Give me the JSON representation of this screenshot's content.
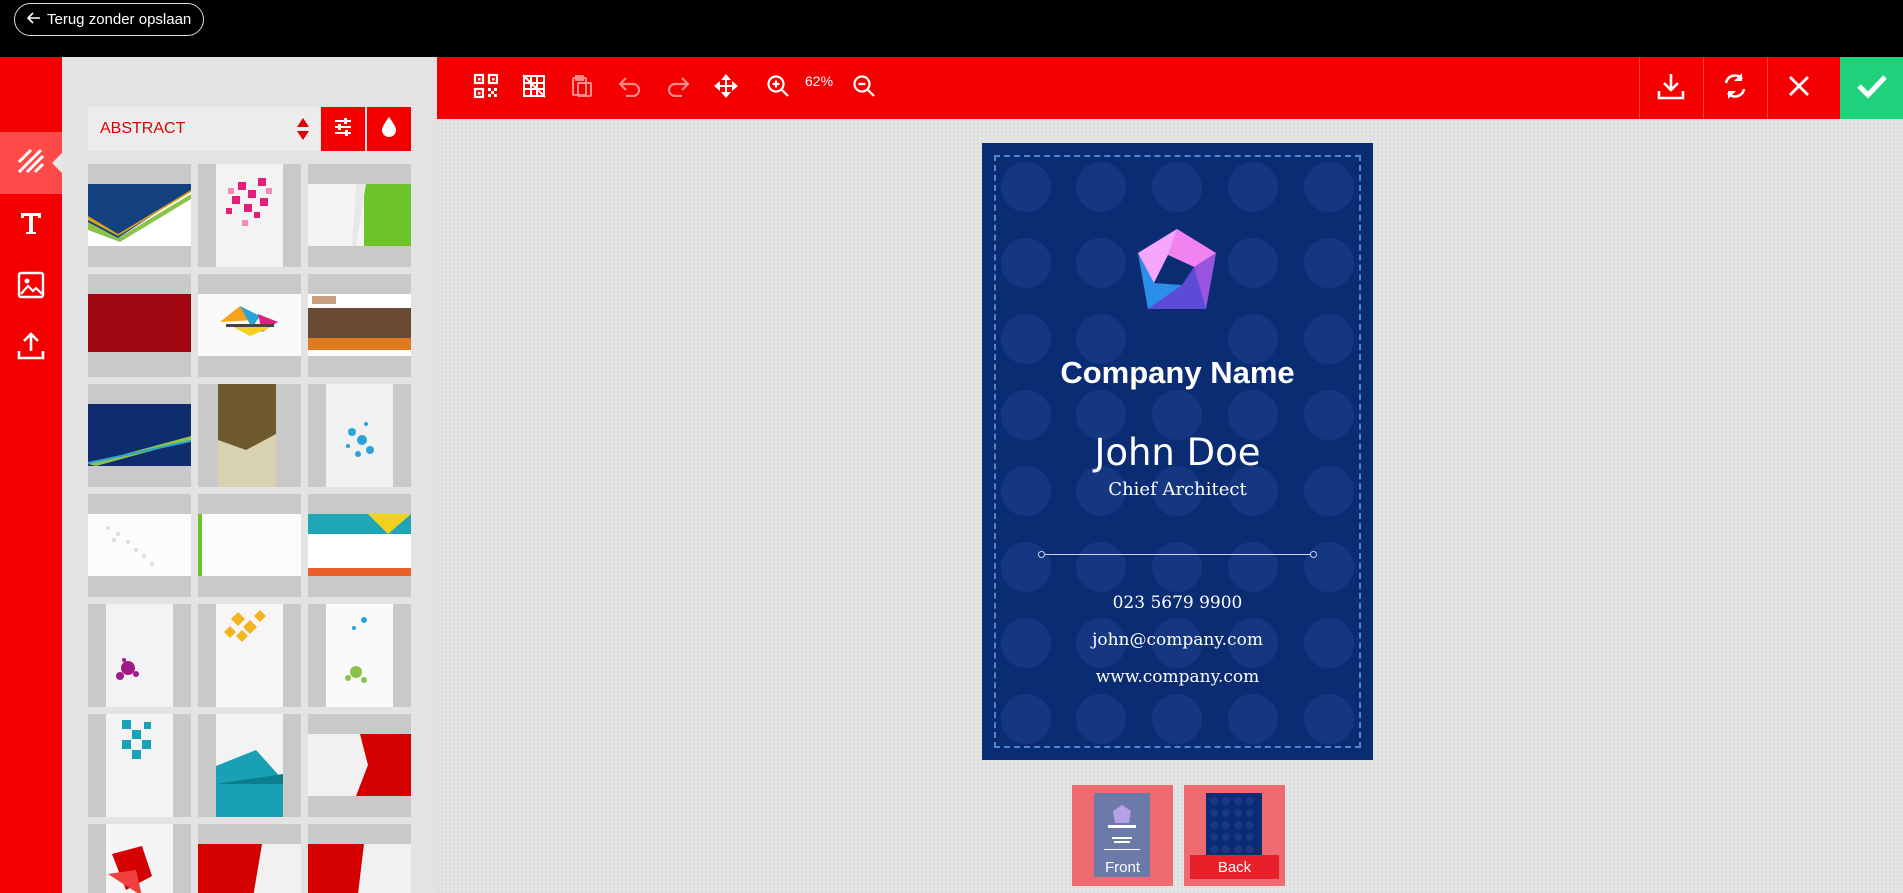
{
  "header": {
    "back_label": "Terug zonder opslaan"
  },
  "sidebar": {
    "items": [
      {
        "name": "backgrounds",
        "icon": "stripes-icon",
        "active": true
      },
      {
        "name": "text",
        "icon": "text-icon",
        "active": false
      },
      {
        "name": "images",
        "icon": "image-icon",
        "active": false
      },
      {
        "name": "upload",
        "icon": "upload-icon",
        "active": false
      }
    ]
  },
  "panel": {
    "category": "ABSTRACT",
    "filter_icon": "sliders-icon",
    "color_icon": "drop-icon",
    "templates": [
      "blue-green-diagonal",
      "pink-pixels",
      "green-corner",
      "dark-red",
      "colorful-triangles",
      "photo-banner",
      "navy-stripe",
      "olive-shape",
      "blue-splatter",
      "white-dots",
      "green-edge",
      "teal-orange-bars",
      "purple-splatter",
      "yellow-diamonds",
      "green-blue-splatter",
      "teal-pixels",
      "teal-shapes",
      "red-wedge",
      "red-triangles",
      "red-panel-a",
      "red-panel-b"
    ]
  },
  "toolbar": {
    "zoom_level": "62%",
    "left_tools": [
      "qr-code-icon",
      "grid-off-icon",
      "paste-icon",
      "undo-icon",
      "redo-icon",
      "move-icon",
      "zoom-in-icon",
      "zoom-out-icon"
    ],
    "right_tools": [
      "download-icon",
      "refresh-icon",
      "close-icon",
      "check-icon"
    ]
  },
  "card": {
    "company": "Company Name",
    "person": "John Doe",
    "role": "Chief Architect",
    "phone": "023 5679 9900",
    "email": "john@company.com",
    "website": "www.company.com"
  },
  "pages": {
    "front_label": "Front",
    "back_label": "Back"
  },
  "colors": {
    "accent": "#f40000",
    "confirm": "#1fd17a",
    "card_bg": "#0a2c73"
  }
}
